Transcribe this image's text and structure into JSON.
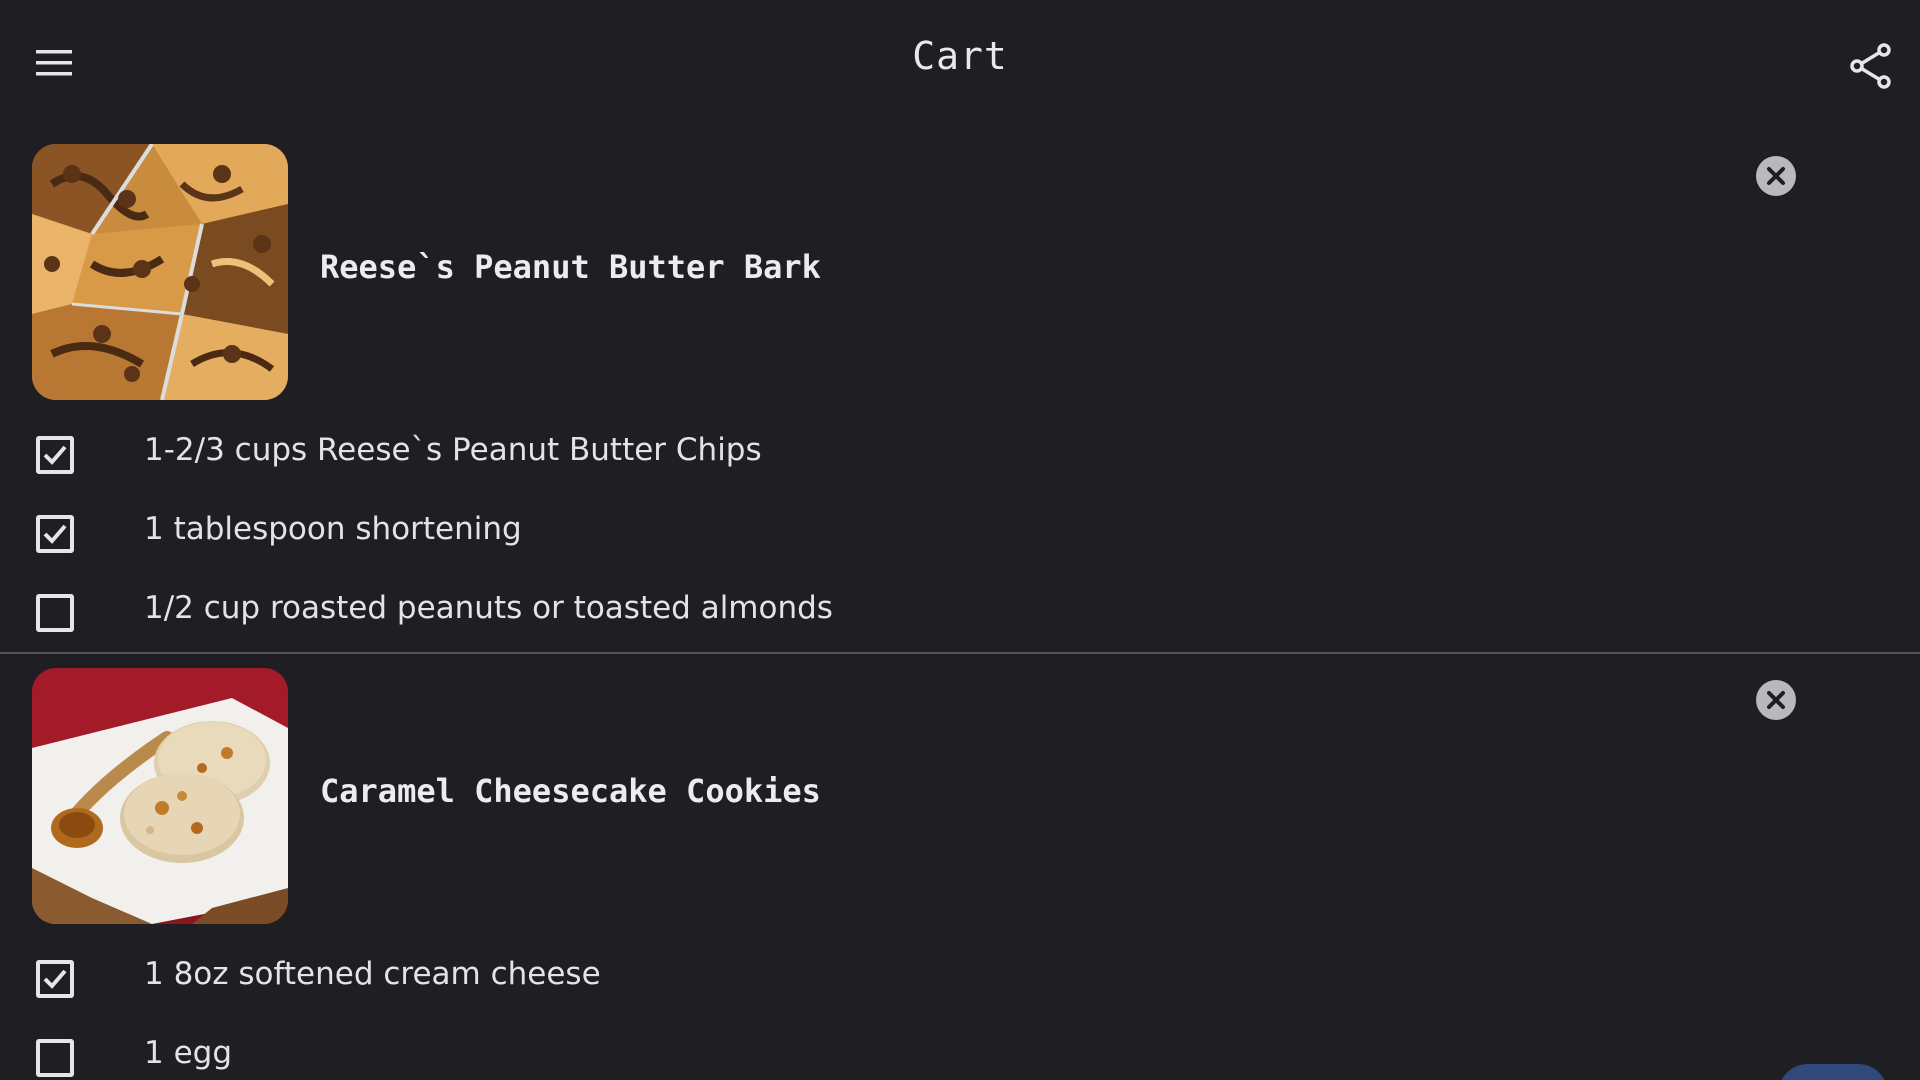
{
  "header": {
    "title": "Cart",
    "menu_icon": "hamburger-menu-icon",
    "share_icon": "share-icon"
  },
  "recipes": [
    {
      "title": "Reese`s Peanut Butter Bark",
      "image": "peanut-butter-bark-photo",
      "remove_icon": "close-circle-icon",
      "ingredients": [
        {
          "text": "1-2/3 cups Reese`s Peanut Butter Chips",
          "checked": true
        },
        {
          "text": "1 tablespoon shortening",
          "checked": true
        },
        {
          "text": "1/2 cup roasted peanuts or toasted almonds",
          "checked": false
        }
      ]
    },
    {
      "title": "Caramel Cheesecake Cookies",
      "image": "caramel-cheesecake-cookies-photo",
      "remove_icon": "close-circle-icon",
      "ingredients": [
        {
          "text": "1 8oz softened cream cheese",
          "checked": true
        },
        {
          "text": "1 egg",
          "checked": false
        }
      ]
    }
  ],
  "colors": {
    "background": "#1f1e23",
    "text": "#e8e8ea",
    "divider": "#55545a",
    "remove_button": "#b8b8bd",
    "fab": "#2f4a7a"
  }
}
